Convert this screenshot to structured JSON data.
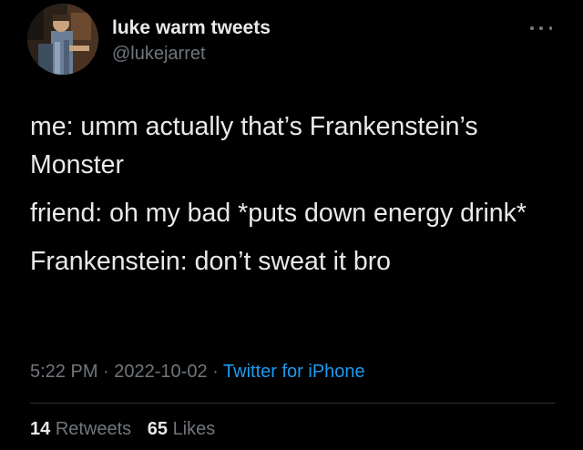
{
  "author": {
    "display_name": "luke warm tweets",
    "handle": "@lukejarret"
  },
  "tweet": {
    "lines": [
      "me: umm actually that’s Frankenstein’s Monster",
      "friend: oh my bad *puts down energy drink*",
      "Frankenstein: don’t sweat it bro"
    ],
    "time": "5:22 PM",
    "date": "2022-10-02",
    "source": "Twitter for iPhone",
    "separator": "·"
  },
  "stats": {
    "retweets_count": "14",
    "retweets_label": "Retweets",
    "likes_count": "65",
    "likes_label": "Likes"
  },
  "icons": {
    "more": "more-horizontal-icon"
  },
  "colors": {
    "background": "#000000",
    "primary_text": "#e7e9ea",
    "secondary_text": "#71767b",
    "link": "#1d9bf0",
    "divider": "#2f3336"
  }
}
